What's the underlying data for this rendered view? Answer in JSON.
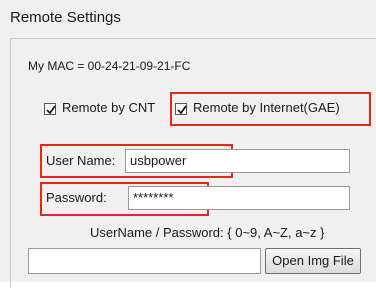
{
  "window": {
    "title": "Remote Settings"
  },
  "mac": {
    "text": "My MAC = 00-24-21-09-21-FC"
  },
  "options": {
    "remote_cnt": {
      "label": "Remote by CNT",
      "checked": true
    },
    "remote_internet": {
      "label": "Remote by Internet(GAE)",
      "checked": true
    }
  },
  "auth": {
    "username_label": "User Name:",
    "username_value": "usbpower",
    "password_label": "Password:",
    "password_value": "********",
    "hint": "UserName / Password: { 0~9, A~Z, a~z }"
  },
  "image": {
    "path_value": "",
    "open_button": "Open Img File"
  },
  "colors": {
    "highlight": "#e52621"
  }
}
